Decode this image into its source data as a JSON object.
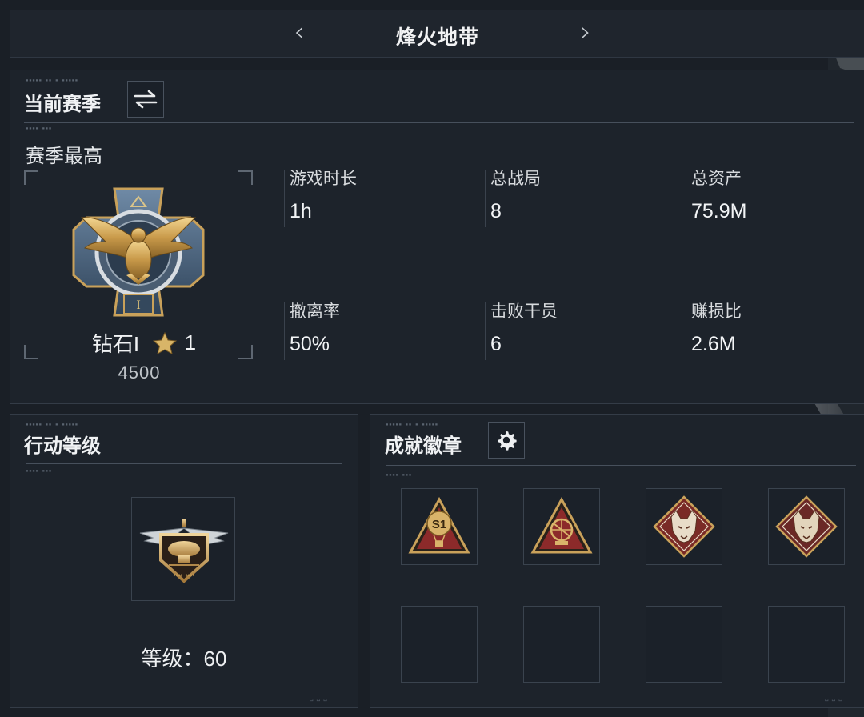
{
  "header": {
    "title": "烽火地带",
    "prev_icon": "chevron-left-icon",
    "next_icon": "chevron-right-icon"
  },
  "season": {
    "title": "当前赛季",
    "switch_icon": "swap-arrows-icon",
    "subtitle": "赛季最高",
    "rank": {
      "name": "钻石I",
      "stars": "1",
      "points": "4500",
      "emblem_icon": "gold-eagle-rank-emblem-icon"
    },
    "stats": [
      {
        "label": "游戏时长",
        "value": "1h"
      },
      {
        "label": "总战局",
        "value": "8"
      },
      {
        "label": "总资产",
        "value": "75.9M"
      },
      {
        "label": "撤离率",
        "value": "50%"
      },
      {
        "label": "击败干员",
        "value": "6"
      },
      {
        "label": "赚损比",
        "value": "2.6M"
      }
    ]
  },
  "level": {
    "title": "行动等级",
    "text": "等级：60",
    "emblem_icon": "helicopter-wings-emblem-icon"
  },
  "badges": {
    "title": "成就徽章",
    "settings_icon": "gear-icon",
    "items": [
      {
        "icon": "s1-balloon-badge-icon",
        "text": "S1"
      },
      {
        "icon": "radar-dish-badge-icon"
      },
      {
        "icon": "wolf-head-badge-icon"
      },
      {
        "icon": "wolf-head-badge-icon"
      },
      {
        "icon": "empty-slot"
      },
      {
        "icon": "empty-slot"
      },
      {
        "icon": "empty-slot"
      },
      {
        "icon": "empty-slot"
      }
    ]
  },
  "colors": {
    "background": "#1a1f26",
    "panel": "#1d232b",
    "border": "#343c47",
    "gold": "#c9a15a",
    "badge_red": "#8c2a2a"
  }
}
